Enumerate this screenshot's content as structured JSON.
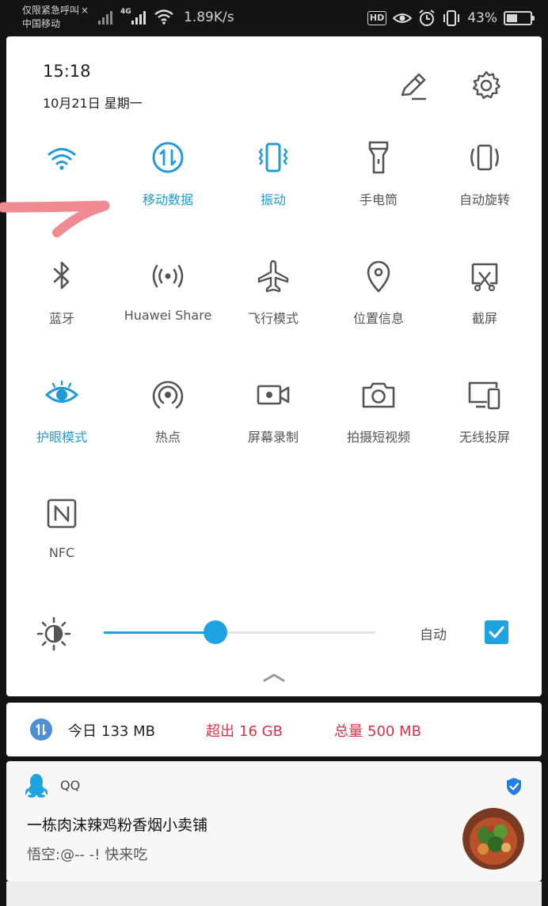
{
  "status_bar": {
    "carrier_line1": "仅限紧急呼叫",
    "carrier_line2": "中国移动",
    "net_type": "4G",
    "speed": "1.89K/s",
    "hd": "HD",
    "battery": "43%"
  },
  "panel": {
    "time": "15:18",
    "date": "10月21日 星期一"
  },
  "tiles": [
    {
      "label": "",
      "icon": "wifi-icon",
      "active": true
    },
    {
      "label": "移动数据",
      "icon": "mobile-data-icon",
      "active": true
    },
    {
      "label": "振动",
      "icon": "vibrate-icon",
      "active": true
    },
    {
      "label": "手电筒",
      "icon": "flashlight-icon",
      "active": false
    },
    {
      "label": "自动旋转",
      "icon": "auto-rotate-icon",
      "active": false
    },
    {
      "label": "蓝牙",
      "icon": "bluetooth-icon",
      "active": false
    },
    {
      "label": "Huawei Share",
      "icon": "huawei-share-icon",
      "active": false
    },
    {
      "label": "飞行模式",
      "icon": "airplane-icon",
      "active": false
    },
    {
      "label": "位置信息",
      "icon": "location-icon",
      "active": false
    },
    {
      "label": "截屏",
      "icon": "screenshot-icon",
      "active": false
    },
    {
      "label": "护眼模式",
      "icon": "eye-comfort-icon",
      "active": true
    },
    {
      "label": "热点",
      "icon": "hotspot-icon",
      "active": false
    },
    {
      "label": "屏幕录制",
      "icon": "screen-record-icon",
      "active": false
    },
    {
      "label": "拍摄短视频",
      "icon": "camera-icon",
      "active": false
    },
    {
      "label": "无线投屏",
      "icon": "wireless-projection-icon",
      "active": false
    },
    {
      "label": "NFC",
      "icon": "nfc-icon",
      "active": false
    }
  ],
  "brightness": {
    "level": 0.41,
    "auto_label": "自动",
    "auto_checked": true
  },
  "data_usage": {
    "today_label": "今日",
    "today_value": "133 MB",
    "exceed_label": "超出",
    "exceed_value": "16 GB",
    "total_label": "总量",
    "total_value": "500 MB"
  },
  "notification": {
    "app": "QQ",
    "title": "一栋肉沫辣鸡粉香烟小卖铺",
    "message": "悟空:@-- -!  快来吃"
  },
  "colors": {
    "accent": "#1f9bd6",
    "inactive": "#555555",
    "warning": "#e0304a",
    "annotation": "#f08a93"
  }
}
